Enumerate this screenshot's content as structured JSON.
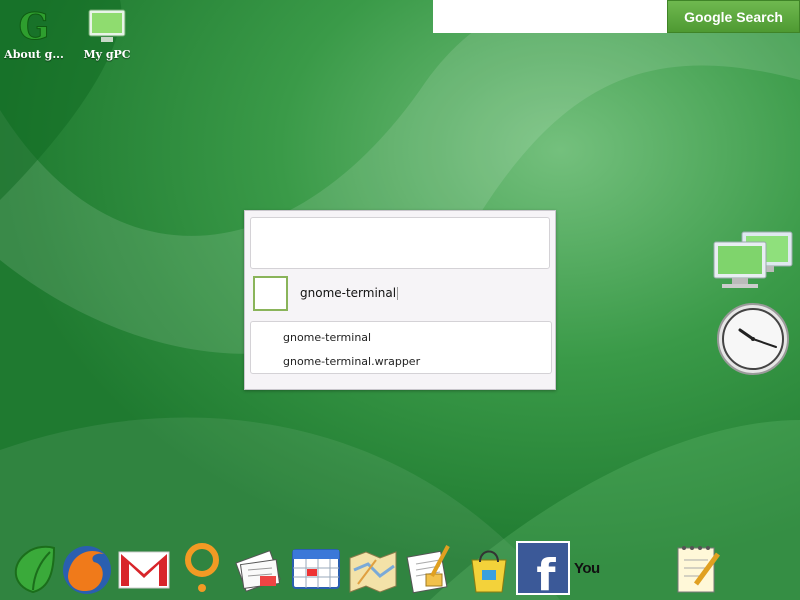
{
  "desktop_icons": [
    {
      "label": "About g...",
      "icon": "google-g-icon"
    },
    {
      "label": "My gPC",
      "icon": "monitor-icon"
    }
  ],
  "search": {
    "value": "",
    "button_label": "Google Search"
  },
  "run_dialog": {
    "input_value": "gnome-terminal",
    "suggestions": [
      "gnome-terminal",
      "gnome-terminal.wrapper"
    ]
  },
  "widgets": [
    "network-icon",
    "clock-icon"
  ],
  "dock": {
    "items": [
      "leaf-icon",
      "firefox-icon",
      "gmail-icon",
      "orkut-icon",
      "news-icon",
      "calendar-icon",
      "maps-icon",
      "docs-icon",
      "shopping-bag-icon",
      "facebook-icon",
      "youtube-icon",
      "notepad-icon"
    ],
    "you_label": "You"
  },
  "colors": {
    "desktop_green": "#2f8a3c",
    "search_button": "#5aa83c",
    "dialog_bg": "#f6f4f7",
    "icon_border": "#8ab45a"
  }
}
